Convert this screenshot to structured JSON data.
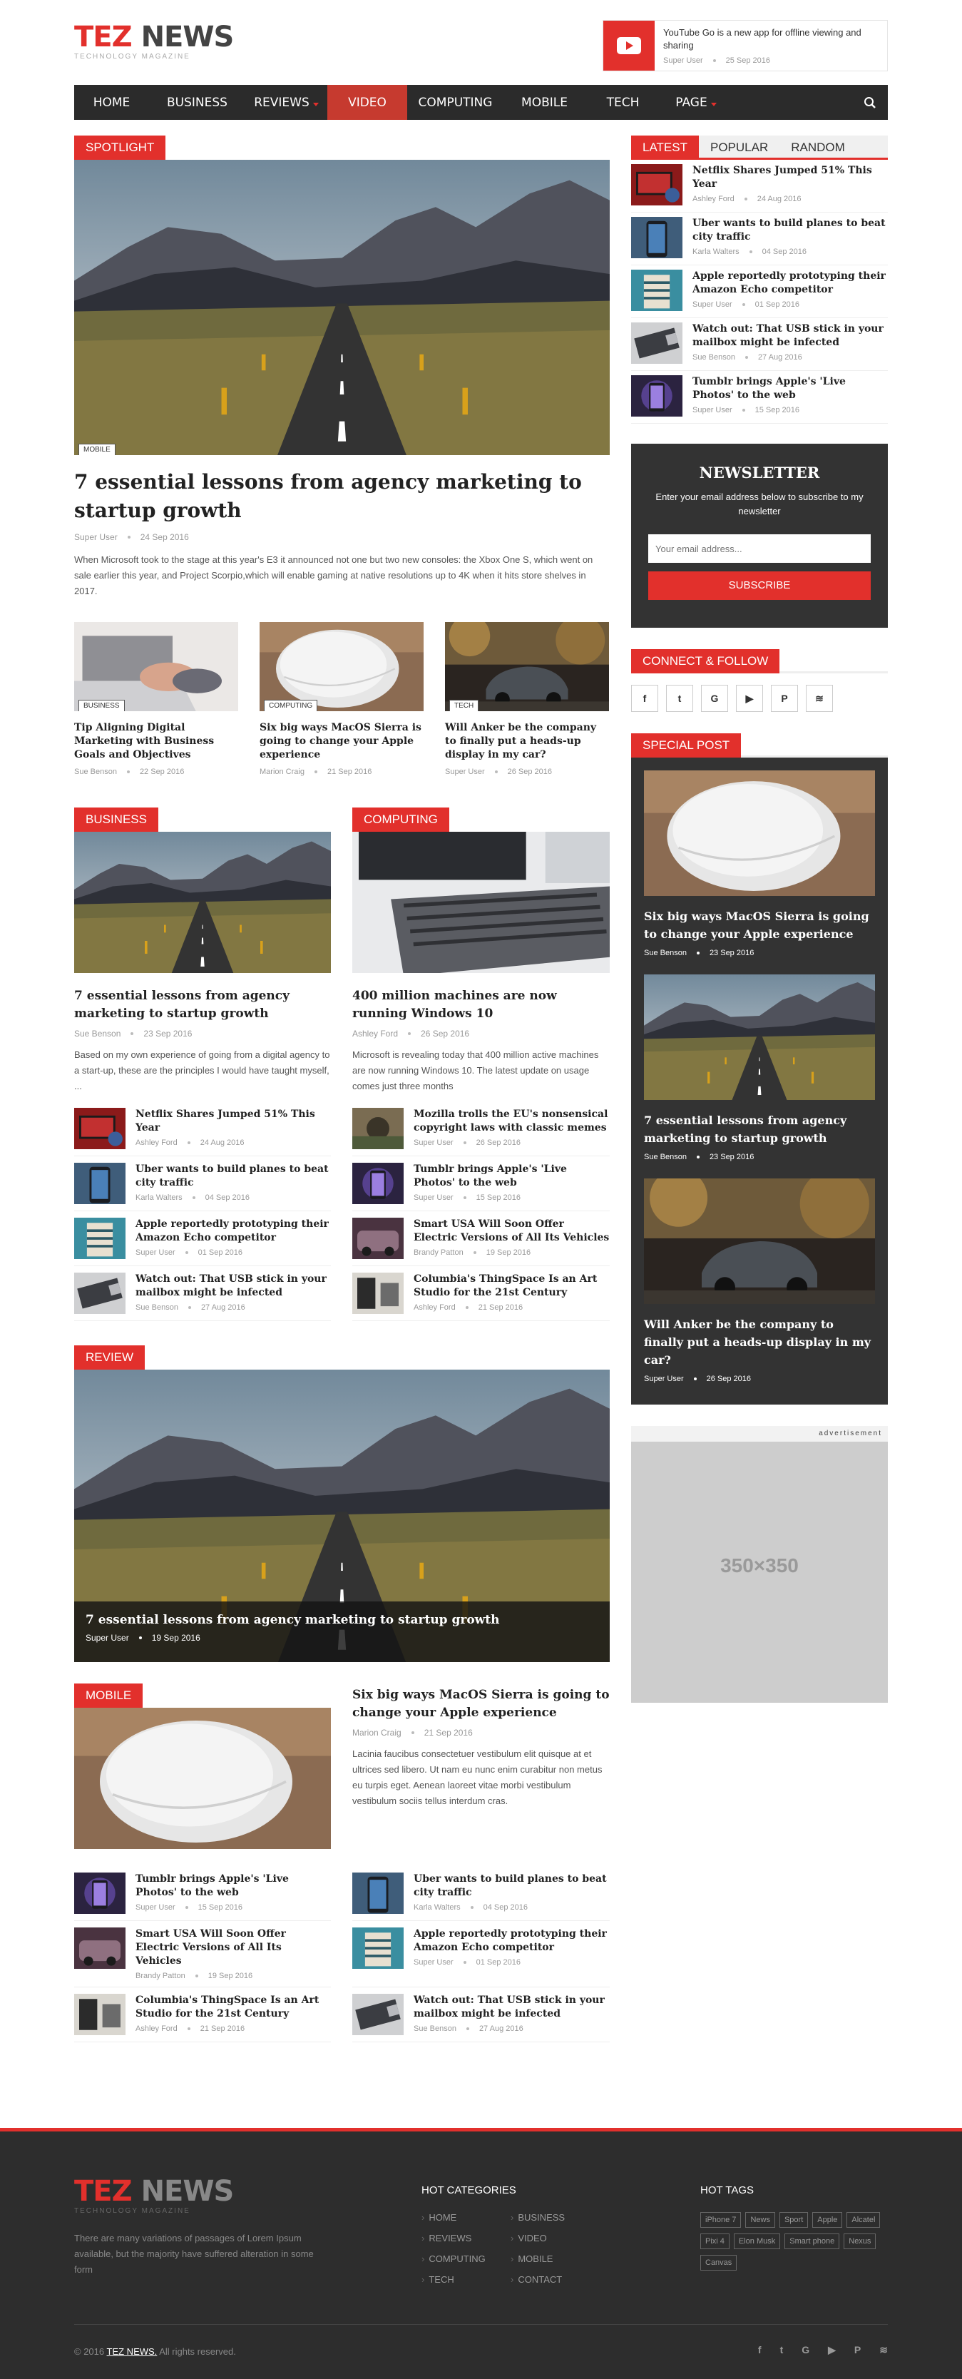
{
  "header": {
    "logo_red": "TEZ",
    "logo_grey": "NEWS",
    "tagline": "TECHNOLOGY MAGAZINE",
    "promo": {
      "title": "YouTube Go is a new app for offline viewing and sharing",
      "author": "Super User",
      "date": "25 Sep 2016"
    }
  },
  "nav": {
    "items": [
      {
        "label": "HOME"
      },
      {
        "label": "BUSINESS"
      },
      {
        "label": "REVIEWS"
      },
      {
        "label": "VIDEO"
      },
      {
        "label": "COMPUTING"
      },
      {
        "label": "MOBILE"
      },
      {
        "label": "TECH"
      },
      {
        "label": "PAGE"
      }
    ],
    "active": "VIDEO",
    "search_icon": "search-icon"
  },
  "spotlight": {
    "label": "SPOTLIGHT",
    "tag": "MOBILE",
    "title": "7 essential lessons from agency marketing to startup growth",
    "author": "Super User",
    "date": "24 Sep 2016",
    "excerpt": "When Microsoft took to the stage at this year's E3 it announced not one but two new consoles: the Xbox One S, which went on sale earlier this year, and Project Scorpio,which will enable gaming at native resolutions up to 4K when it hits store shelves in 2017.",
    "cards": [
      {
        "tag": "BUSINESS",
        "title": "Tip Aligning Digital Marketing with Business Goals and Objectives",
        "author": "Sue Benson",
        "date": "22 Sep 2016"
      },
      {
        "tag": "COMPUTING",
        "title": "Six big ways MacOS Sierra is going to change your Apple experience",
        "author": "Marion Craig",
        "date": "21 Sep 2016"
      },
      {
        "tag": "TECH",
        "title": "Will Anker be the company to finally put a heads-up display in my car?",
        "author": "Super User",
        "date": "26 Sep 2016"
      }
    ]
  },
  "tabs": {
    "items": [
      "LATEST",
      "POPULAR",
      "RANDOM"
    ],
    "active": "LATEST",
    "posts": [
      {
        "title": "Netflix Shares Jumped 51% This Year",
        "author": "Ashley Ford",
        "date": "24 Aug 2016"
      },
      {
        "title": "Uber wants to build planes to beat city traffic",
        "author": "Karla Walters",
        "date": "04 Sep 2016"
      },
      {
        "title": "Apple reportedly prototyping their Amazon Echo competitor",
        "author": "Super User",
        "date": "01 Sep 2016"
      },
      {
        "title": "Watch out: That USB stick in your mailbox might be infected",
        "author": "Sue Benson",
        "date": "27 Aug 2016"
      },
      {
        "title": "Tumblr brings Apple's 'Live Photos' to the web",
        "author": "Super User",
        "date": "15 Sep 2016"
      }
    ]
  },
  "newsletter": {
    "title": "NEWSLETTER",
    "text": "Enter your email address below to subscribe to my newsletter",
    "placeholder": "Your email address...",
    "button": "SUBSCRIBE"
  },
  "connect": {
    "label": "CONNECT & FOLLOW",
    "icons": [
      "facebook-icon",
      "twitter-icon",
      "google-icon",
      "youtube-icon",
      "pinterest-icon",
      "rss-icon"
    ]
  },
  "special": {
    "label": "SPECIAL POST",
    "posts": [
      {
        "title": "Six big ways MacOS Sierra is going to change your Apple experience",
        "author": "Sue Benson",
        "date": "23 Sep 2016"
      },
      {
        "title": "7 essential lessons from agency marketing to startup growth",
        "author": "Sue Benson",
        "date": "23 Sep 2016"
      },
      {
        "title": "Will Anker be the company to finally put a heads-up display in my car?",
        "author": "Super User",
        "date": "26 Sep 2016"
      }
    ]
  },
  "ad": {
    "label": "advertisement",
    "size": "350×350"
  },
  "business": {
    "label": "BUSINESS",
    "title": "7 essential lessons from agency marketing to startup growth",
    "author": "Sue Benson",
    "date": "23 Sep 2016",
    "excerpt": "Based on my own experience of going from a digital agency to a start-up, these are the principles I would have taught myself, ...",
    "items": [
      {
        "title": "Netflix Shares Jumped 51% This Year",
        "author": "Ashley Ford",
        "date": "24 Aug 2016"
      },
      {
        "title": "Uber wants to build planes to beat city traffic",
        "author": "Karla Walters",
        "date": "04 Sep 2016"
      },
      {
        "title": "Apple reportedly prototyping their Amazon Echo competitor",
        "author": "Super User",
        "date": "01 Sep 2016"
      },
      {
        "title": "Watch out: That USB stick in your mailbox might be infected",
        "author": "Sue Benson",
        "date": "27 Aug 2016"
      }
    ]
  },
  "computing": {
    "label": "COMPUTING",
    "title": "400 million machines are now running Windows 10",
    "author": "Ashley Ford",
    "date": "26 Sep 2016",
    "excerpt": "Microsoft is revealing today that 400 million active machines are now running Windows 10. The latest update on usage comes just three months",
    "items": [
      {
        "title": "Mozilla trolls the EU's nonsensical copyright laws with classic memes",
        "author": "Super User",
        "date": "26 Sep 2016"
      },
      {
        "title": "Tumblr brings Apple's 'Live Photos' to the web",
        "author": "Super User",
        "date": "15 Sep 2016"
      },
      {
        "title": "Smart USA Will Soon Offer Electric Versions of All Its Vehicles",
        "author": "Brandy Patton",
        "date": "19 Sep 2016"
      },
      {
        "title": "Columbia's ThingSpace Is an Art Studio for the 21st Century",
        "author": "Ashley Ford",
        "date": "21 Sep 2016"
      }
    ]
  },
  "review": {
    "label": "REVIEW",
    "title": "7 essential lessons from agency marketing to startup growth",
    "author": "Super User",
    "date": "19 Sep 2016"
  },
  "mobile": {
    "label": "MOBILE",
    "title": "Six big ways MacOS Sierra is going to change your Apple experience",
    "author": "Marion Craig",
    "date": "21 Sep 2016",
    "excerpt": "Lacinia faucibus consectetuer vestibulum elit quisque at et ultrices sed libero. Ut nam eu nunc enim curabitur non metus eu turpis eget. Aenean laoreet vitae morbi vestibulum vestibulum sociis tellus interdum cras.",
    "items": [
      {
        "title": "Tumblr brings Apple's 'Live Photos' to the web",
        "author": "Super User",
        "date": "15 Sep 2016"
      },
      {
        "title": "Uber wants to build planes to beat city traffic",
        "author": "Karla Walters",
        "date": "04 Sep 2016"
      },
      {
        "title": "Smart USA Will Soon Offer Electric Versions of All Its Vehicles",
        "author": "Brandy Patton",
        "date": "19 Sep 2016"
      },
      {
        "title": "Apple reportedly prototyping their Amazon Echo competitor",
        "author": "Super User",
        "date": "01 Sep 2016"
      },
      {
        "title": "Columbia's ThingSpace Is an Art Studio for the 21st Century",
        "author": "Ashley Ford",
        "date": "21 Sep 2016"
      },
      {
        "title": "Watch out: That USB stick in your mailbox might be infected",
        "author": "Sue Benson",
        "date": "27 Aug 2016"
      }
    ]
  },
  "footer": {
    "logo_red": "TEZ",
    "logo_grey": "NEWS",
    "tagline": "TECHNOLOGY MAGAZINE",
    "about": "There are many variations of passages of Lorem Ipsum available, but the majority have suffered alteration in some form",
    "hot_categories_title": "HOT CATEGORIES",
    "categories": [
      "HOME",
      "BUSINESS",
      "REVIEWS",
      "VIDEO",
      "COMPUTING",
      "MOBILE",
      "TECH",
      "CONTACT"
    ],
    "hot_tags_title": "HOT TAGS",
    "tags": [
      "iPhone 7",
      "News",
      "Sport",
      "Apple",
      "Alcatel",
      "Pixi 4",
      "Elon Musk",
      "Smart phone",
      "Nexus",
      "Canvas"
    ],
    "copyright_pre": "© 2016",
    "copyright_link": "TEZ NEWS.",
    "copyright_post": "All rights reserved.",
    "social": [
      "facebook-icon",
      "twitter-icon",
      "google-icon",
      "youtube-icon",
      "pinterest-icon",
      "rss-icon"
    ]
  },
  "colors": {
    "accent": "#e2302c",
    "nav_bg": "#2b2b2b",
    "dark_panel": "#333333",
    "footer_bg": "#2d2d2d"
  }
}
